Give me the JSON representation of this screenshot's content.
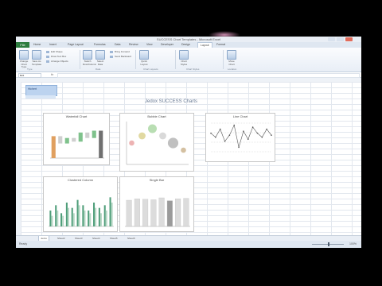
{
  "window": {
    "title": "SUCCESS Chart Templates - Microsoft Excel"
  },
  "tabs": [
    {
      "label": "Home"
    },
    {
      "label": "Insert"
    },
    {
      "label": "Page Layout"
    },
    {
      "label": "Formulas"
    },
    {
      "label": "Data"
    },
    {
      "label": "Review"
    },
    {
      "label": "View"
    },
    {
      "label": "Developer"
    },
    {
      "label": "Design"
    },
    {
      "label": "Layout"
    },
    {
      "label": "Format"
    }
  ],
  "file_tab": "File",
  "ribbon": {
    "buttons": [
      {
        "label": "Change Chart Type"
      },
      {
        "label": "Save As Template"
      },
      {
        "label": "Switch Row/Column"
      },
      {
        "label": "Select Data"
      },
      {
        "label": "Quick Layout"
      },
      {
        "label": "Chart Styles"
      },
      {
        "label": "Move Chart"
      }
    ],
    "small_items": [
      {
        "label": "Edit Shape"
      },
      {
        "label": "Draw Text Box"
      },
      {
        "label": "Arrange Objects"
      },
      {
        "label": "Bring Forward"
      },
      {
        "label": "Send Backward"
      }
    ],
    "groups": [
      {
        "label": "Type"
      },
      {
        "label": "Data"
      },
      {
        "label": "Chart Layouts"
      },
      {
        "label": "Chart Styles"
      },
      {
        "label": "Location"
      }
    ]
  },
  "formula_bar": {
    "name_box": "B24",
    "fx": "fx",
    "value": ""
  },
  "sheet": {
    "selected_cell_label": "Hichert"
  },
  "dashboard_title": "Jedox SUCCESS Charts",
  "charts": [
    {
      "title": "Waterfall Chart"
    },
    {
      "title": "Bubble Chart"
    },
    {
      "title": "Line Chart"
    },
    {
      "title": "Clustered Column"
    },
    {
      "title": "Single Bar"
    }
  ],
  "chart_data": [
    {
      "type": "bar",
      "title": "Waterfall Chart",
      "categories": [
        "1",
        "2",
        "3",
        "4",
        "5",
        "6",
        "7",
        "8"
      ],
      "values": [
        60,
        -20,
        15,
        -10,
        25,
        -15,
        20,
        75
      ],
      "colors": [
        "#e0a060",
        "#cfcfcf",
        "#7fc28c",
        "#cfcfcf",
        "#7fc28c",
        "#cfcfcf",
        "#7fc28c",
        "#707070"
      ]
    },
    {
      "type": "scatter",
      "title": "Bubble Chart",
      "x": [
        1,
        2,
        3,
        4,
        5,
        6
      ],
      "y": [
        3,
        4,
        5,
        4,
        3,
        2
      ],
      "sizes": [
        3,
        4,
        5,
        4,
        6,
        3
      ]
    },
    {
      "type": "line",
      "title": "Line Chart",
      "x": [
        1,
        2,
        3,
        4,
        5,
        6,
        7,
        8,
        9,
        10,
        11,
        12,
        13,
        14
      ],
      "values": [
        10,
        8,
        12,
        6,
        9,
        14,
        3,
        11,
        7,
        13,
        10,
        8,
        12,
        9
      ]
    },
    {
      "type": "bar",
      "title": "Clustered Column",
      "categories": [
        "1",
        "2",
        "3",
        "4",
        "5",
        "6",
        "7",
        "8",
        "9",
        "10",
        "11",
        "12"
      ],
      "series": [
        {
          "values": [
            6,
            8,
            5,
            9,
            7,
            10,
            8,
            6,
            9,
            7,
            8,
            11
          ]
        },
        {
          "values": [
            4,
            6,
            4,
            7,
            5,
            8,
            6,
            5,
            7,
            5,
            6,
            9
          ]
        }
      ]
    },
    {
      "type": "bar",
      "title": "Single Bar",
      "categories": [
        "1",
        "2",
        "3",
        "4",
        "5",
        "6",
        "7",
        "8"
      ],
      "values": [
        55,
        58,
        57,
        56,
        60,
        54,
        58,
        59
      ]
    }
  ],
  "sheet_tabs": [
    {
      "label": "Jedox"
    },
    {
      "label": "Sheet2"
    },
    {
      "label": "Sheet3"
    },
    {
      "label": "Sheet4"
    },
    {
      "label": "Sheet5"
    },
    {
      "label": "Sheet6"
    }
  ],
  "status": {
    "ready": "Ready",
    "zoom": "100%"
  },
  "colors": {
    "excel_green": "#2d7d3f",
    "accent_green": "#7fc28c",
    "accent_orange": "#e0a060"
  }
}
